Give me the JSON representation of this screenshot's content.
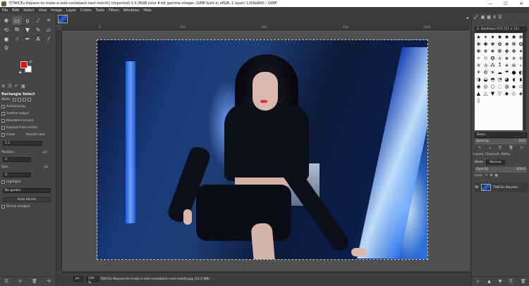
{
  "window": {
    "title": "*[TWICEs-Nayeon-to-make-a-solo-comeback-next-month] (imported)-1.0 (RGB color 8-bit gamma integer, GIMP built-in sRGB, 1 layer) 1200x800 – GIMP",
    "minimize": "—",
    "maximize": "☐",
    "close": "✕"
  },
  "menu": [
    "File",
    "Edit",
    "Select",
    "View",
    "Image",
    "Layer",
    "Colors",
    "Tools",
    "Filters",
    "Windows",
    "Help"
  ],
  "toolbox": {
    "tools": [
      {
        "name": "move-tool-icon",
        "glyph": "✥"
      },
      {
        "name": "rect-select-tool-icon",
        "glyph": "▭"
      },
      {
        "name": "lasso-tool-icon",
        "glyph": "ϙ"
      },
      {
        "name": "fuzzy-select-tool-icon",
        "glyph": "⁄"
      },
      {
        "name": "crop-tool-icon",
        "glyph": "⌗"
      },
      {
        "name": "transform-tool-icon",
        "glyph": "⟲"
      },
      {
        "name": "warp-tool-icon",
        "glyph": "⧉"
      },
      {
        "name": "paint-bucket-tool-icon",
        "glyph": "▼"
      },
      {
        "name": "paintbrush-tool-icon",
        "glyph": "✎"
      },
      {
        "name": "eraser-tool-icon",
        "glyph": "▱"
      },
      {
        "name": "clone-tool-icon",
        "glyph": "◉"
      },
      {
        "name": "smudge-tool-icon",
        "glyph": "☝"
      },
      {
        "name": "paths-tool-icon",
        "glyph": "✒"
      },
      {
        "name": "text-tool-icon",
        "glyph": "A"
      },
      {
        "name": "color-picker-tool-icon",
        "glyph": "⁄"
      },
      {
        "name": "zoom-tool-icon",
        "glyph": "⚲"
      }
    ],
    "tabs": [
      "⚙",
      "☰",
      "↶",
      "▦"
    ],
    "options_title": "Rectangle Select",
    "mode_label": "Mode:",
    "antialiasing": "Antialiasing",
    "feather": "Feather edges",
    "rounded": "Rounded corners",
    "expand": "Expand from center",
    "fixed": "Fixed",
    "aspect": "Aspect ratio",
    "ratio_value": "1:1",
    "position_label": "Position:",
    "position_unit": "px",
    "pos_x": "0",
    "pos_y": "0",
    "size_label": "Size:",
    "size_unit": "px",
    "size_w": "0",
    "size_h": "0",
    "highlight": "Highlight",
    "guides": "No guides",
    "auto_shrink": "Auto Shrink",
    "shrink_merged": "Shrink merged"
  },
  "canvas": {
    "ruler_marks": [
      "0",
      "250",
      "500",
      "750",
      "1000"
    ],
    "unit": "px",
    "zoom": "100 %",
    "status": "TWICEs-Nayeon-to-make-a-solo-comeback-next-month.jpg (12,4 MB)"
  },
  "dock": {
    "tabs": [
      "🖌",
      "▦",
      "▩",
      "A",
      "☰"
    ],
    "brush_filter": "2. Hardness 075 (51 × 51)",
    "brushes": [
      "★",
      "✶",
      "✷",
      "✸",
      "✹",
      "✺",
      "✻",
      "❋",
      "✽",
      "✾",
      "✿",
      "❀",
      "❁",
      "❂",
      "❃",
      "❄",
      "❅",
      "❆",
      "✤",
      "✥",
      "✦",
      "✧",
      "✩",
      "✪",
      "✫",
      "✬",
      "✭",
      "✮",
      "✯",
      "✰",
      "⁂",
      "⁑",
      "∗",
      "⊛",
      "⋆",
      "⚘",
      "⚙",
      "☀",
      "☁",
      "☂",
      "●",
      "◐",
      "◑",
      "◒",
      "◓",
      "◔",
      "◕",
      "◖",
      "◗",
      "◉",
      "◎",
      "○",
      "◌",
      "◍",
      "▪",
      "▫",
      "▲",
      "△",
      "▼",
      "▽",
      "◆",
      "◇",
      "◈",
      "◊"
    ],
    "basic_label": "Basic,",
    "spacing_label": "Spacing",
    "spacing_value": "10,0",
    "panel_tabs": [
      "Layers",
      "Channels",
      "Paths"
    ],
    "mode_label": "Mode",
    "mode_value": "Normal",
    "opacity_label": "Opacity",
    "opacity_value": "100,0",
    "lock_label": "Lock:",
    "layer_name": "TWICEs-Nayeon..."
  }
}
